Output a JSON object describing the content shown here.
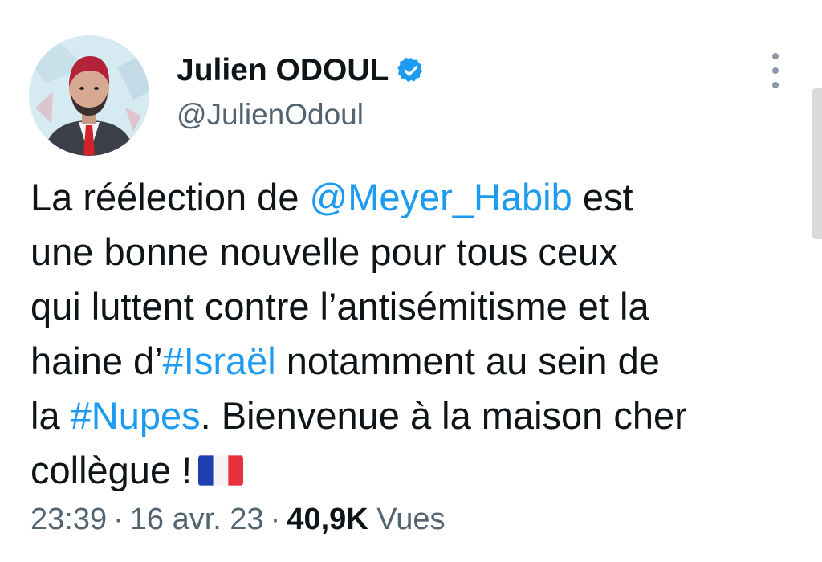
{
  "author": {
    "display_name": "Julien ODOUL",
    "handle": "@JulienOdoul",
    "verified": true,
    "avatar_icon": "profile-photo"
  },
  "tweet": {
    "lines": [
      [
        {
          "text": "La réélection de "
        },
        {
          "text": "@Meyer_Habib",
          "link": true
        },
        {
          "text": " est"
        }
      ],
      [
        {
          "text": "une bonne nouvelle pour tous ceux"
        }
      ],
      [
        {
          "text": "qui luttent contre l’antisémitisme et la"
        }
      ],
      [
        {
          "text": "haine d’"
        },
        {
          "text": "#Israël",
          "link": true
        },
        {
          "text": " notamment au sein de"
        }
      ],
      [
        {
          "text": "la "
        },
        {
          "text": "#Nupes",
          "link": true
        },
        {
          "text": ". Bienvenue à la maison cher"
        }
      ],
      [
        {
          "text": "collègue !"
        },
        {
          "emoji": "french-flag-emoji"
        }
      ]
    ]
  },
  "meta": {
    "time": "23:39",
    "separator": "·",
    "date": "16 avr. 23",
    "views_count": "40,9K",
    "views_label": "Vues"
  },
  "colors": {
    "link": "#1d9bf0",
    "text": "#0f1419",
    "secondary": "#536471",
    "verified": "#1d9bf0"
  },
  "icons": {
    "more": "more-vertical-icon",
    "verified": "verified-badge-icon"
  }
}
